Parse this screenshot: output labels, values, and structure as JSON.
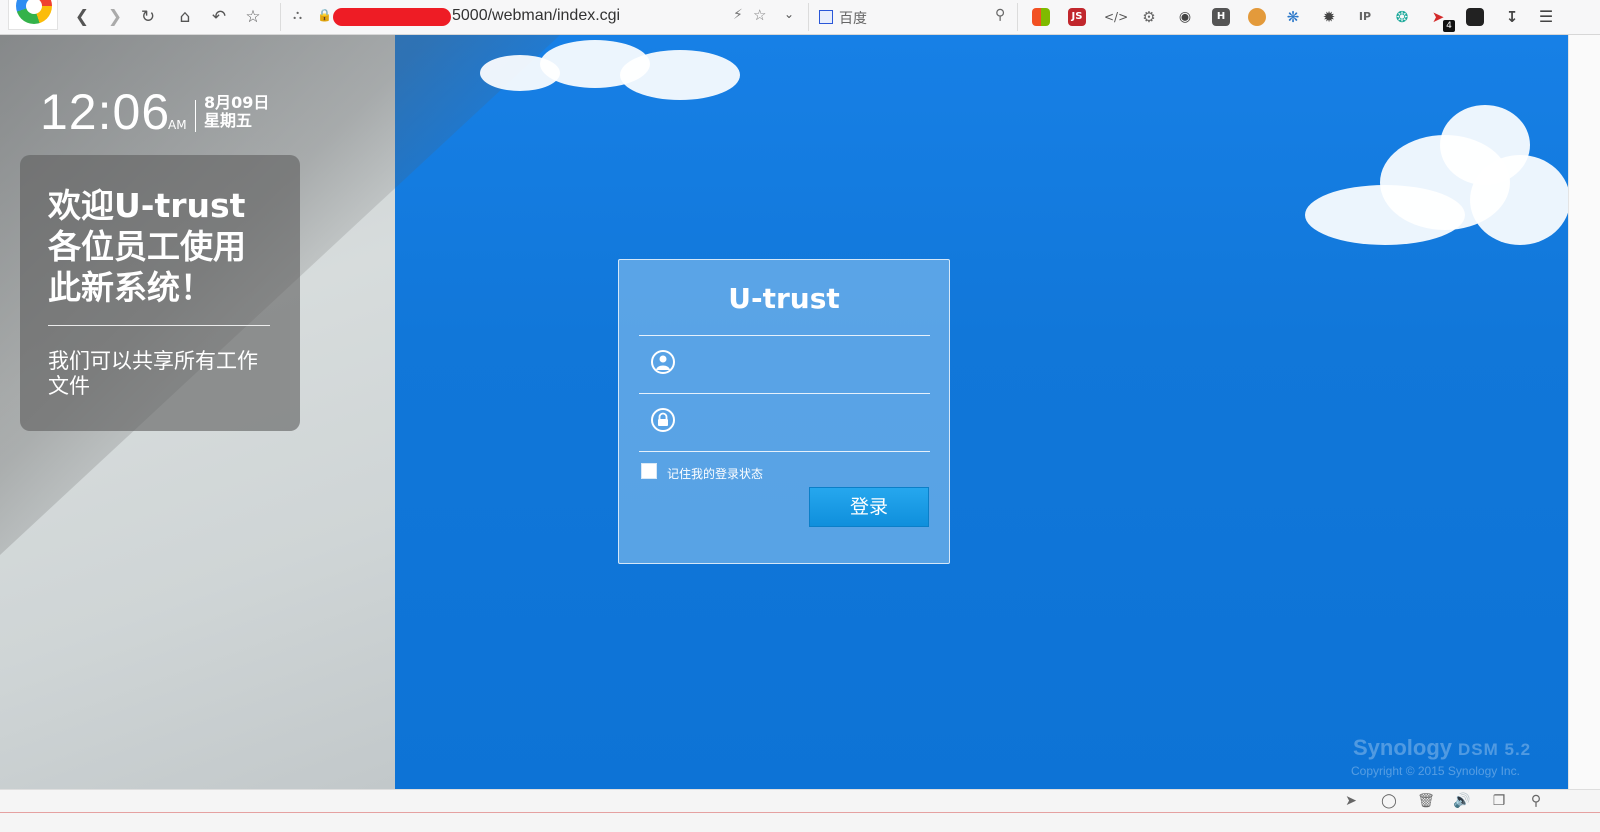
{
  "browser": {
    "url": "5000/webman/index.cgi",
    "search_engine": "百度",
    "extension_badge": "4",
    "nav_icons": [
      "back-icon",
      "forward-icon",
      "reload-icon",
      "home-icon",
      "undo-icon",
      "bookmark-star-icon"
    ],
    "extension_icons": [
      "windows-icon",
      "js-icon",
      "code-icon",
      "gear-icon",
      "gauge-icon",
      "h-icon",
      "cookie-icon",
      "puzzle-icon",
      "settings-icon",
      "ip-icon",
      "globe-icon",
      "link-icon",
      "ghost-icon",
      "download-icon",
      "menu-icon"
    ]
  },
  "clock": {
    "time": "12:06",
    "ampm": "AM",
    "date": "8月09日",
    "weekday": "星期五"
  },
  "welcome": {
    "title": "欢迎U-trust各位员工使用此新系统！",
    "subtitle": "我们可以共享所有工作文件"
  },
  "login": {
    "title": "U-trust",
    "username_value": "",
    "password_value": "",
    "remember_label": "记住我的登录状态",
    "remember_checked": false,
    "button_label": "登录"
  },
  "footer": {
    "brand": "Synology",
    "version": "DSM 5.2",
    "copyright": "Copyright © 2015 Synology Inc."
  },
  "colors": {
    "sky": "#1177d9",
    "login_button": "#1a9be6",
    "redaction": "#ee1c25"
  }
}
